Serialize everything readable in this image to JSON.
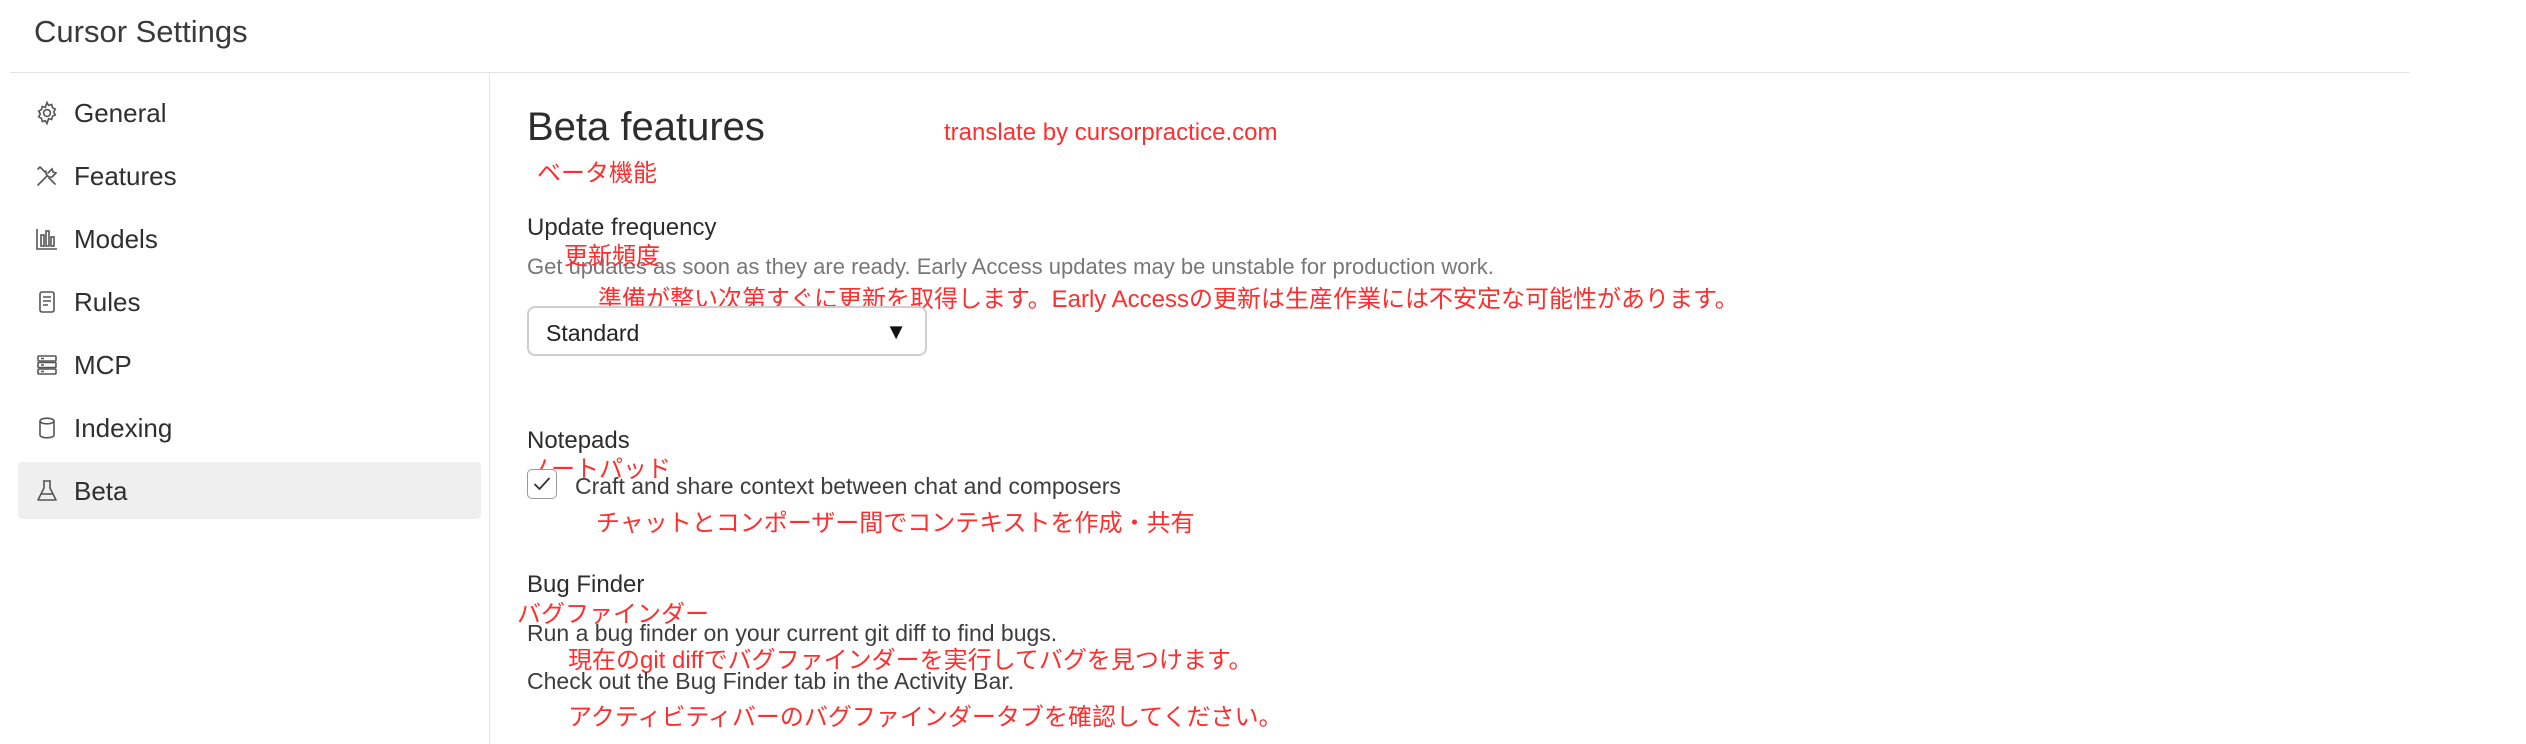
{
  "app": {
    "title": "Cursor Settings"
  },
  "sidebar": {
    "items": [
      {
        "label": "General",
        "icon": "gear-icon",
        "active": false
      },
      {
        "label": "Features",
        "icon": "tools-icon",
        "active": false
      },
      {
        "label": "Models",
        "icon": "bar-chart-icon",
        "active": false
      },
      {
        "label": "Rules",
        "icon": "document-icon",
        "active": false
      },
      {
        "label": "MCP",
        "icon": "server-icon",
        "active": false
      },
      {
        "label": "Indexing",
        "icon": "database-icon",
        "active": false
      },
      {
        "label": "Beta",
        "icon": "flask-icon",
        "active": true
      }
    ]
  },
  "main": {
    "title": "Beta features",
    "title_jp": "ベータ機能",
    "credit": "translate by cursorpractice.com",
    "update_frequency": {
      "title": "Update frequency",
      "title_jp": "更新頻度",
      "description": "Get updates as soon as they are ready. Early Access updates may be unstable for production work.",
      "description_jp": "準備が整い次第すぐに更新を取得します。Early Accessの更新は生産作業には不安定な可能性があります。",
      "selected": "Standard",
      "caret": "▼"
    },
    "notepads": {
      "title": "Notepads",
      "title_jp": "ノートパッド",
      "checkbox_label": "Craft and share context between chat and composers",
      "checkbox_label_jp": "チャットとコンポーザー間でコンテキストを作成・共有",
      "checked": true
    },
    "bug_finder": {
      "title": "Bug Finder",
      "title_jp": "バグファインダー",
      "description": "Run a bug finder on your current git diff to find bugs.",
      "description_jp": "現在のgit diffでバグファインダーを実行してバグを見つけます。",
      "note": "Check out the Bug Finder tab in the Activity Bar.",
      "note_jp": "アクティビティバーのバグファインダータブを確認してください。"
    }
  },
  "colors": {
    "translation_red": "#ff2e2e",
    "active_nav_bg": "#efefef",
    "divider": "#e3e3e3"
  }
}
